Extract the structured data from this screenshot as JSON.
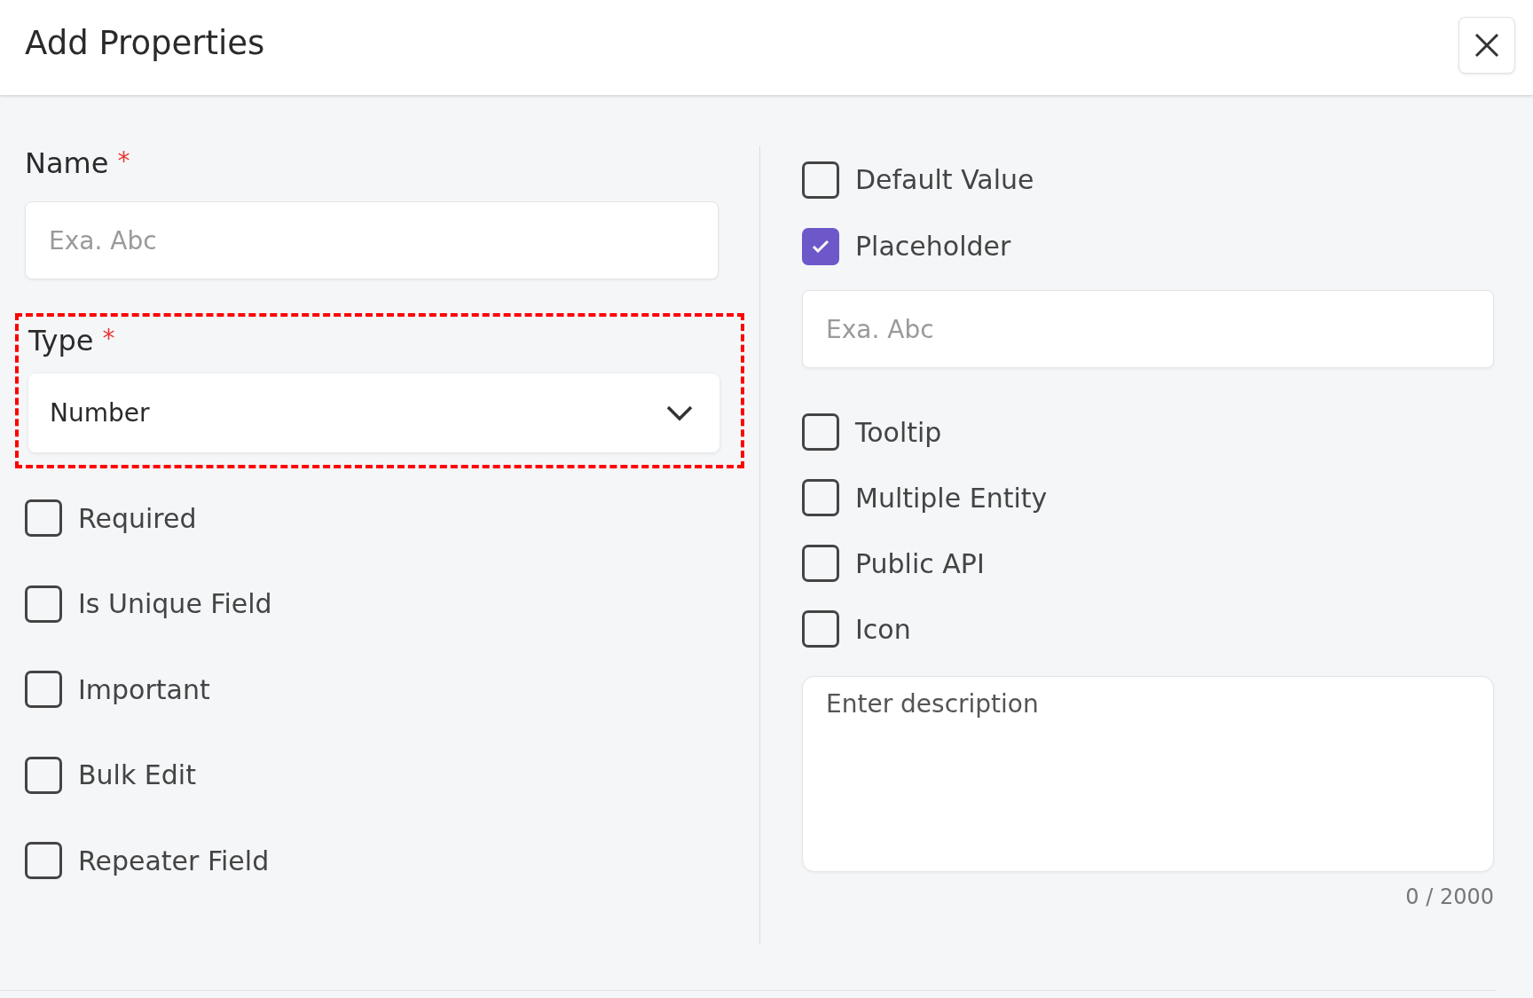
{
  "dialog": {
    "title": "Add Properties"
  },
  "name_field": {
    "label": "Name",
    "required_mark": "*",
    "placeholder": "Exa. Abc"
  },
  "type_field": {
    "label": "Type",
    "required_mark": "*",
    "value": "Number",
    "highlighted": true
  },
  "left_options": [
    {
      "label": "Required",
      "checked": false
    },
    {
      "label": "Is Unique Field",
      "checked": false
    },
    {
      "label": "Important",
      "checked": false
    },
    {
      "label": "Bulk Edit",
      "checked": false
    },
    {
      "label": "Repeater Field",
      "checked": false
    }
  ],
  "right_options_top": [
    {
      "label": "Default Value",
      "checked": false
    },
    {
      "label": "Placeholder",
      "checked": true
    }
  ],
  "placeholder_field": {
    "placeholder": "Exa. Abc"
  },
  "right_options_bottom": [
    {
      "label": "Tooltip",
      "checked": false
    },
    {
      "label": "Multiple Entity",
      "checked": false
    },
    {
      "label": "Public API",
      "checked": false
    },
    {
      "label": "Icon",
      "checked": false
    }
  ],
  "description": {
    "placeholder": "Enter description",
    "counter": "0 / 2000"
  }
}
